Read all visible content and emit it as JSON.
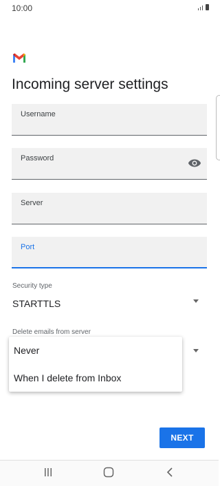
{
  "status_bar": {
    "time": "10:00"
  },
  "page": {
    "title": "Incoming server settings"
  },
  "fields": {
    "username_label": "Username",
    "password_label": "Password",
    "server_label": "Server",
    "port_label": "Port"
  },
  "security": {
    "label": "Security type",
    "value": "STARTTLS"
  },
  "delete_emails": {
    "label": "Delete emails from server",
    "options": [
      "Never",
      "When I delete from Inbox"
    ]
  },
  "actions": {
    "next_label": "NEXT"
  },
  "icons": {
    "logo": "gmail-logo",
    "password_toggle": "eye-icon",
    "nav_recents": "recents-icon",
    "nav_home": "home-icon",
    "nav_back": "back-icon"
  },
  "colors": {
    "accent": "#1a73e8",
    "field_bg": "#f1f1f1",
    "gmail_red": "#ea4335"
  }
}
